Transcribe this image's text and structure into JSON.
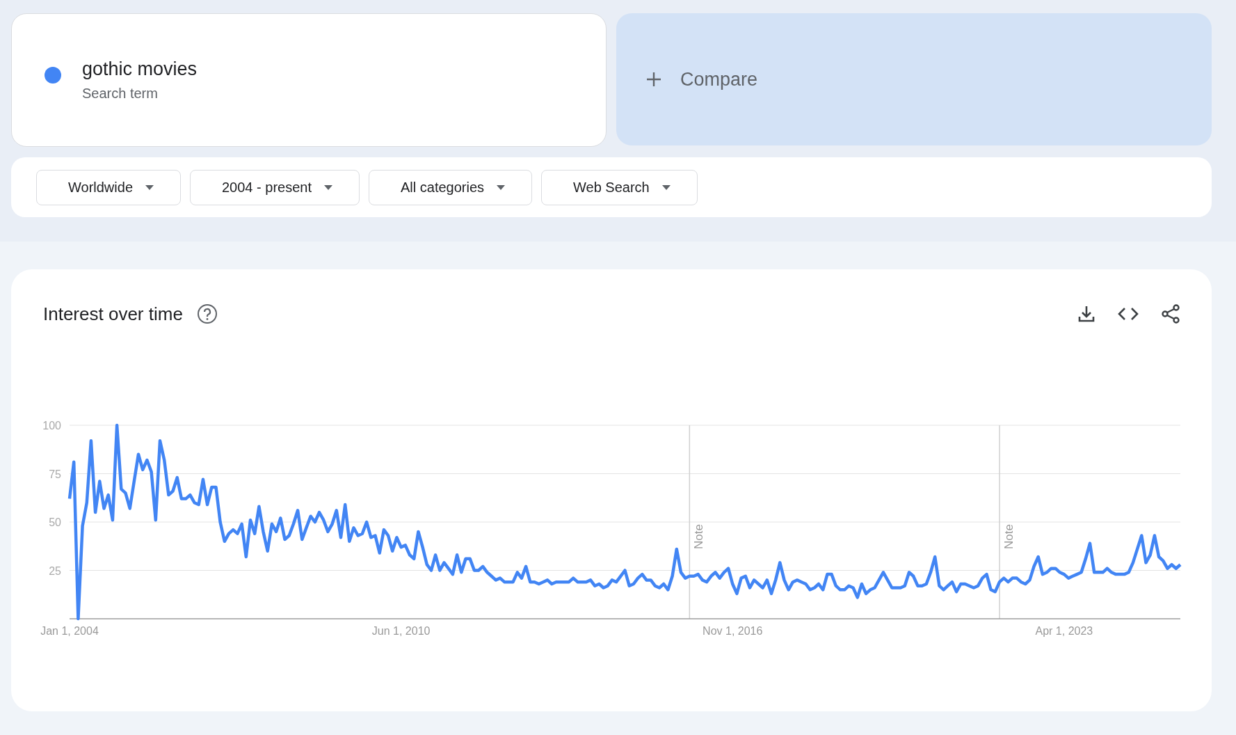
{
  "search_term": {
    "color": "#4285f4",
    "term": "gothic movies",
    "label": "Search term"
  },
  "compare": {
    "label": "Compare"
  },
  "filters": [
    {
      "label": "Worldwide"
    },
    {
      "label": "2004 - present"
    },
    {
      "label": "All categories"
    },
    {
      "label": "Web Search"
    }
  ],
  "interest_over_time": {
    "title": "Interest over time",
    "chart_data": {
      "type": "line",
      "ylim": [
        0,
        100
      ],
      "yticks": [
        25,
        50,
        75,
        100
      ],
      "categories": [
        "Jan 1, 2004",
        null,
        null,
        null,
        null,
        null,
        null,
        null,
        null,
        null,
        null,
        null,
        null,
        null,
        null,
        null,
        null,
        null,
        null,
        null,
        null,
        null,
        null,
        null,
        null,
        null,
        null,
        null,
        null,
        null,
        null,
        null,
        null,
        null,
        null,
        null,
        null,
        null,
        null,
        null,
        null,
        null,
        null,
        null,
        null,
        null,
        null,
        null,
        null,
        null,
        null,
        null,
        null,
        null,
        null,
        null,
        null,
        null,
        null,
        null,
        null,
        null,
        null,
        null,
        null,
        null,
        null,
        null,
        null,
        null,
        null,
        null,
        null,
        null,
        null,
        null,
        null,
        "Jun 1, 2010",
        null,
        null,
        null,
        null,
        null,
        null,
        null,
        null,
        null,
        null,
        null,
        null,
        null,
        null,
        null,
        null,
        null,
        null,
        null,
        null,
        null,
        null,
        null,
        null,
        null,
        null,
        null,
        null,
        null,
        null,
        null,
        null,
        null,
        null,
        null,
        null,
        null,
        null,
        null,
        null,
        null,
        null,
        null,
        null,
        null,
        null,
        null,
        null,
        null,
        null,
        null,
        null,
        null,
        null,
        null,
        null,
        null,
        null,
        null,
        null,
        null,
        null,
        null,
        null,
        null,
        null,
        null,
        null,
        null,
        null,
        null,
        null,
        null,
        null,
        null,
        null,
        "Nov 1, 2016",
        null,
        null,
        null,
        null,
        null,
        null,
        null,
        null,
        null,
        null,
        null,
        null,
        null,
        null,
        null,
        null,
        null,
        null,
        null,
        null,
        null,
        null,
        null,
        null,
        null,
        null,
        null,
        null,
        null,
        null,
        null,
        null,
        null,
        null,
        null,
        null,
        null,
        null,
        null,
        null,
        null,
        null,
        null,
        null,
        null,
        null,
        null,
        null,
        null,
        null,
        null,
        null,
        null,
        null,
        null,
        null,
        null,
        null,
        null,
        null,
        null,
        null,
        null,
        null,
        null,
        null,
        null,
        null,
        null,
        null,
        null,
        null,
        null,
        null,
        null,
        null,
        "Apr 1, 2023",
        null,
        null,
        null,
        null,
        null,
        null,
        null,
        null,
        null,
        null,
        null,
        null,
        null,
        null,
        null,
        null,
        null,
        null,
        null,
        null,
        null,
        null,
        null,
        null,
        null,
        null,
        null
      ],
      "annotations": [
        "Note",
        "Note"
      ],
      "grid": true,
      "series": [
        {
          "color": "#4285f4",
          "values": [
            62,
            81,
            0,
            48,
            60,
            92,
            55,
            71,
            57,
            64,
            51,
            100,
            67,
            65,
            57,
            71,
            85,
            77,
            82,
            76,
            51,
            92,
            82,
            64,
            66,
            73,
            62,
            62,
            64,
            60,
            59,
            72,
            59,
            68,
            68,
            50,
            40,
            44,
            46,
            44,
            49,
            32,
            51,
            44,
            58,
            45,
            35,
            49,
            45,
            52,
            41,
            43,
            49,
            56,
            41,
            47,
            53,
            50,
            55,
            51,
            45,
            49,
            56,
            42,
            59,
            40,
            47,
            43,
            44,
            50,
            42,
            43,
            34,
            46,
            43,
            35,
            42,
            37,
            38,
            33,
            31,
            45,
            37,
            28,
            25,
            33,
            25,
            29,
            26,
            23,
            33,
            24,
            31,
            31,
            25,
            25,
            27,
            24,
            22,
            20,
            21,
            19,
            19,
            19,
            24,
            21,
            27,
            19,
            19,
            18,
            19,
            20,
            18,
            19,
            19,
            19,
            19,
            21,
            19,
            19,
            19,
            20,
            17,
            18,
            16,
            17,
            20,
            19,
            22,
            25,
            17,
            18,
            21,
            23,
            20,
            20,
            17,
            16,
            18,
            15,
            22,
            36,
            24,
            21,
            22,
            22,
            23,
            20,
            19,
            22,
            24,
            21,
            24,
            26,
            18,
            13,
            21,
            22,
            16,
            20,
            18,
            16,
            20,
            13,
            20,
            29,
            20,
            15,
            19,
            20,
            19,
            18,
            15,
            16,
            18,
            15,
            23,
            23,
            17,
            15,
            15,
            17,
            16,
            11,
            18,
            13,
            15,
            16,
            20,
            24,
            20,
            16,
            16,
            16,
            17,
            24,
            22,
            17,
            17,
            18,
            24,
            32,
            17,
            15,
            17,
            19,
            14,
            18,
            18,
            17,
            16,
            17,
            21,
            23,
            15,
            14,
            19,
            21,
            19,
            21,
            21,
            19,
            18,
            20,
            27,
            32,
            23,
            24,
            26,
            26,
            24,
            23,
            21,
            22,
            23,
            24,
            31,
            39,
            24,
            24,
            24,
            26,
            24,
            23,
            23,
            23,
            24,
            29,
            36,
            43,
            29,
            33,
            43,
            32,
            30,
            26,
            28,
            26,
            28
          ]
        }
      ]
    }
  }
}
